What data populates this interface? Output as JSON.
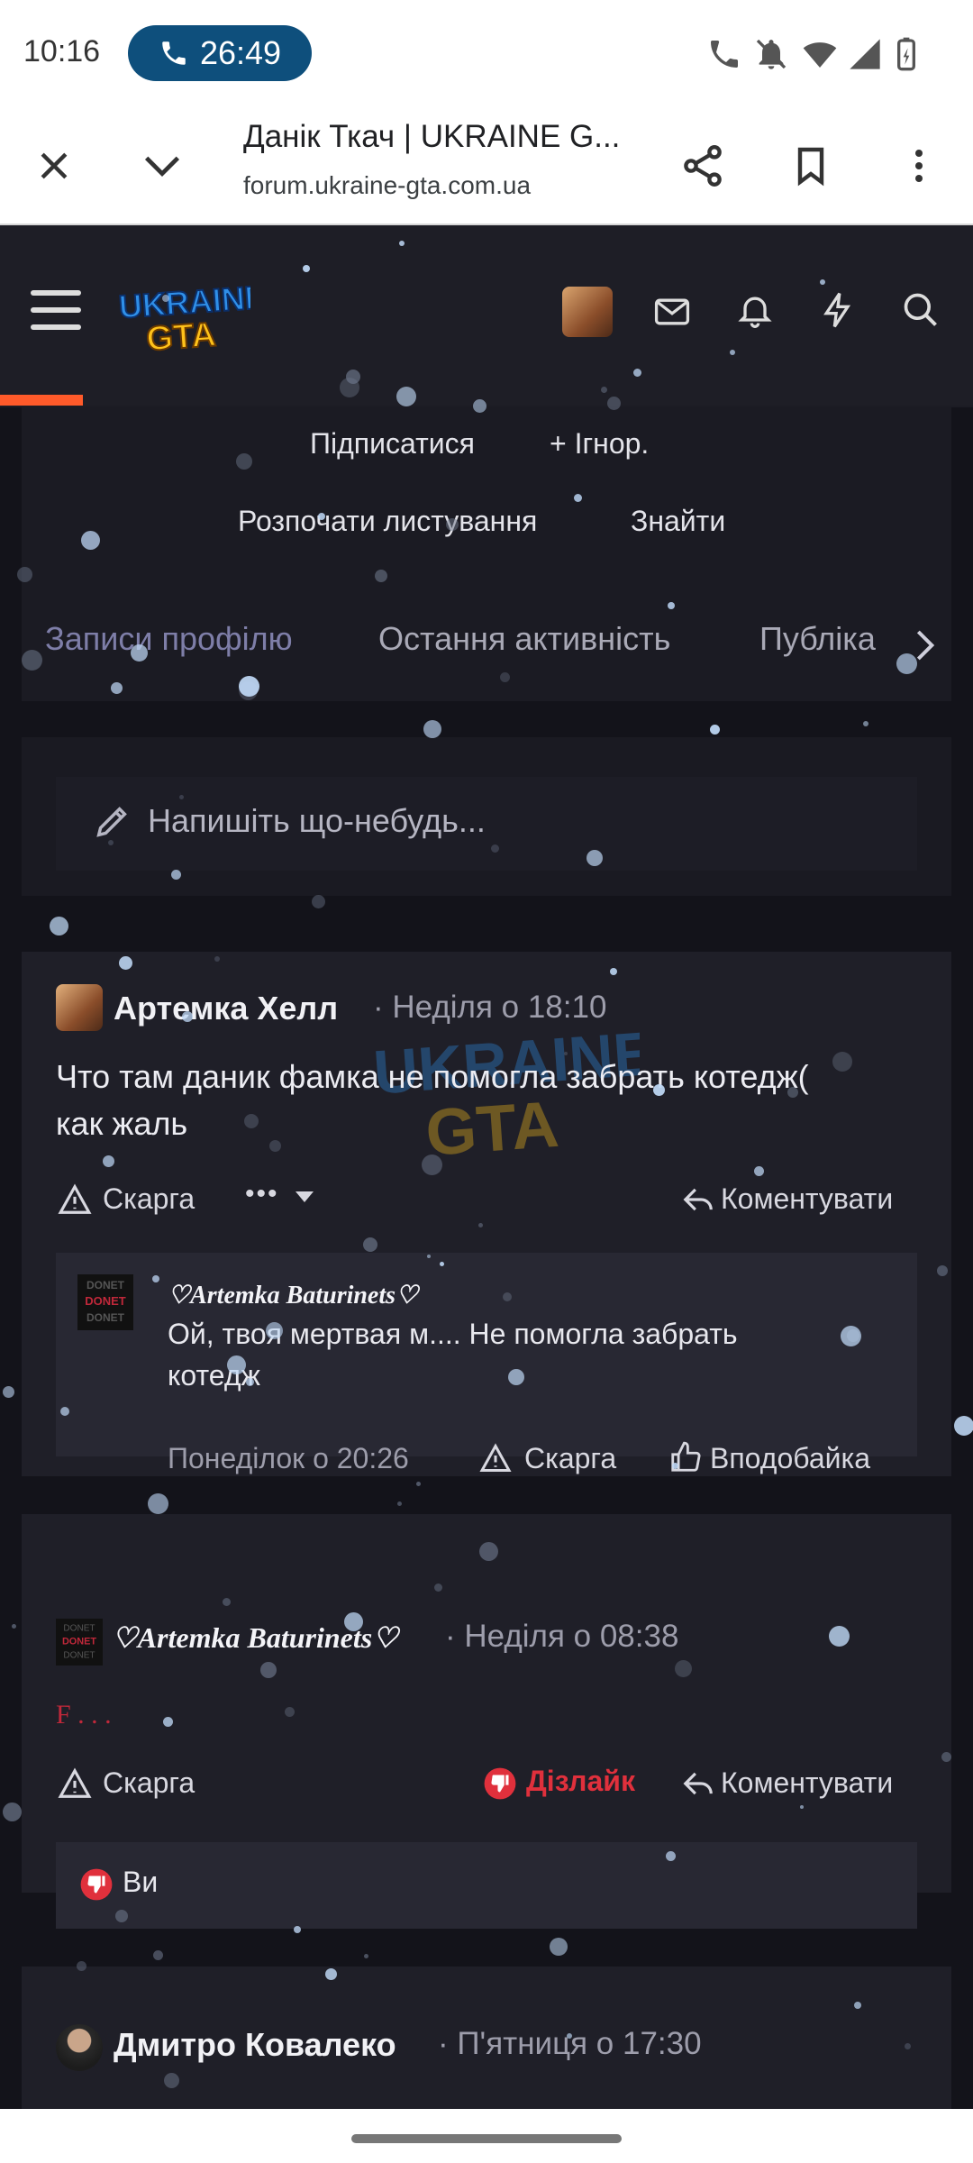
{
  "status_bar": {
    "time": "10:16",
    "call_timer": "26:49"
  },
  "browser": {
    "page_title": "Данік Ткач | UKRAINE G...",
    "url": "forum.ukraine-gta.com.ua"
  },
  "site": {
    "logo_text": "UKRAINE GTA"
  },
  "profile_actions": {
    "follow": "Підписатися",
    "ignore": "+ Ігнор.",
    "start_conversation": "Розпочати листування",
    "find": "Знайти"
  },
  "tabs": [
    "Записи профілю",
    "Остання активність",
    "Публіка"
  ],
  "composer": {
    "placeholder": "Напишіть що-небудь..."
  },
  "posts": [
    {
      "author": "Артемка Хелл",
      "time": "· Неділя о 18:10",
      "text_line1": "Что там даник фамка не помогла забрать котедж(",
      "text_line2": "как жаль",
      "report": "Скарга",
      "more": "•••",
      "comment": "Коментувати",
      "reply": {
        "author": "♡Artemka Baturinets♡",
        "text_line1": "Ой, твоя мертвая м.... Не помогла забрать",
        "text_line2": "котедж",
        "time": "Понеділок о 20:26",
        "report": "Скарга",
        "like": "Вподобайка"
      }
    },
    {
      "author": "♡Artemka Baturinets♡",
      "time": "· Неділя о 08:38",
      "text": "F . . .",
      "report": "Скарга",
      "dislike": "Дізлайк",
      "comment": "Коментувати",
      "reactions": "Ви"
    },
    {
      "author": "Дмитро Ковалеко",
      "time": "· П'ятниця о 17:30"
    }
  ],
  "colors": {
    "accent": "#ff5a2a",
    "tab_active": "#7e7ea8",
    "dislike": "#e0303c",
    "call_pill": "#0e4f7c"
  }
}
